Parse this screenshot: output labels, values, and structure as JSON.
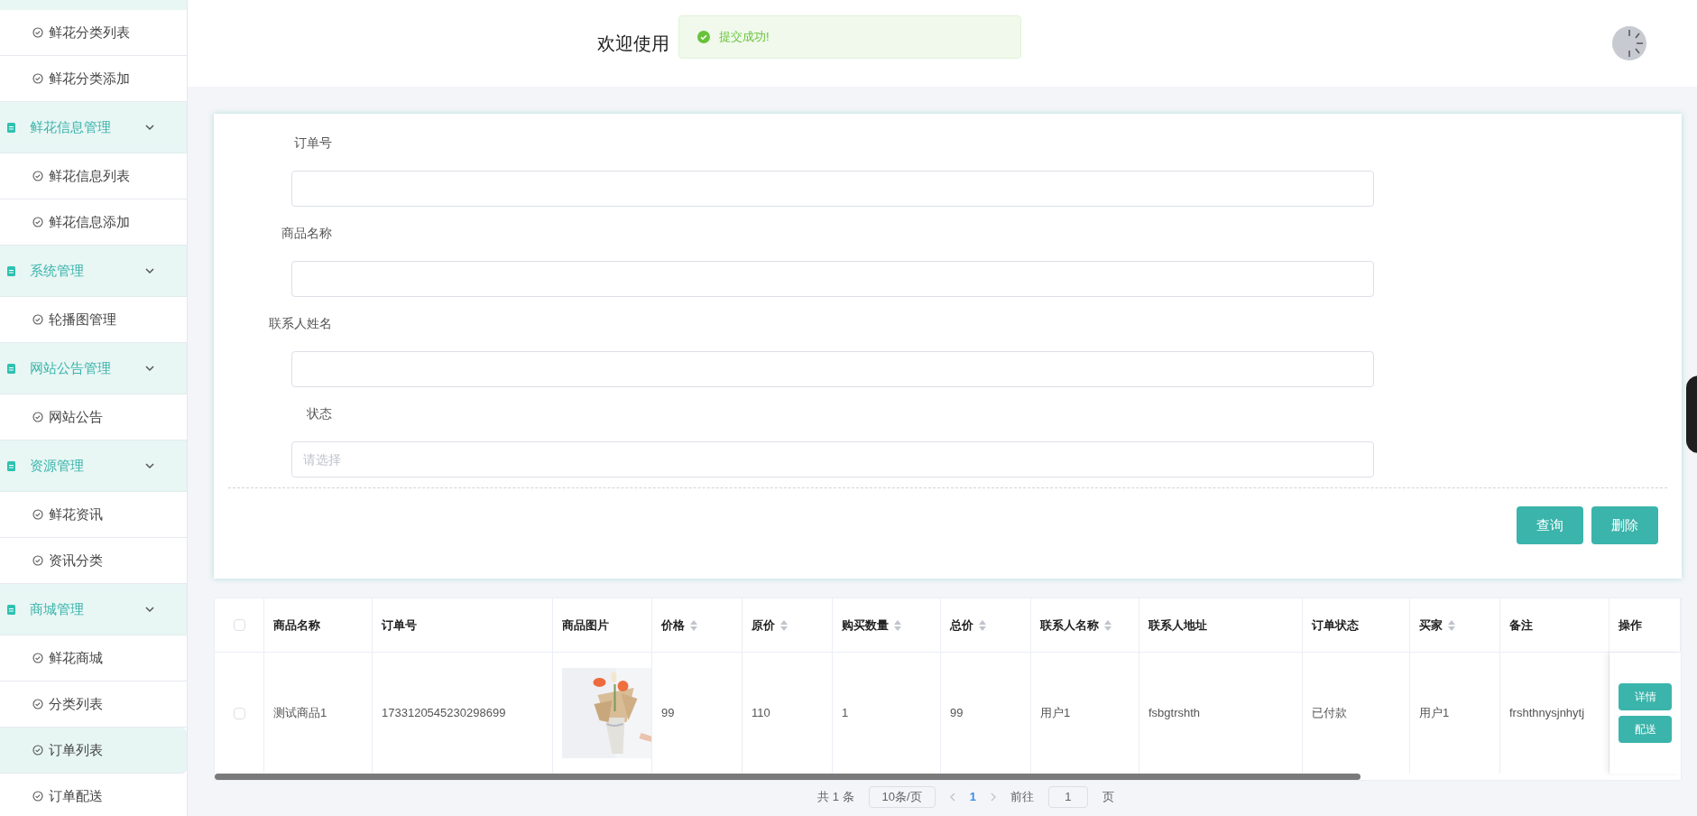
{
  "sidebar": {
    "items": [
      {
        "children": [
          {
            "label": "鲜花分类列表",
            "selected": false
          },
          {
            "label": "鲜花分类添加",
            "selected": false
          }
        ]
      },
      {
        "label": "鲜花信息管理",
        "expanded": true,
        "children": [
          {
            "label": "鲜花信息列表",
            "selected": false
          },
          {
            "label": "鲜花信息添加",
            "selected": false
          }
        ]
      },
      {
        "label": "系统管理",
        "expanded": true,
        "children": [
          {
            "label": "轮播图管理",
            "selected": false
          }
        ]
      },
      {
        "label": "网站公告管理",
        "expanded": true,
        "children": [
          {
            "label": "网站公告",
            "selected": false
          }
        ]
      },
      {
        "label": "资源管理",
        "expanded": true,
        "children": [
          {
            "label": "鲜花资讯",
            "selected": false
          },
          {
            "label": "资讯分类",
            "selected": false
          }
        ]
      },
      {
        "label": "商城管理",
        "expanded": true,
        "children": [
          {
            "label": "鲜花商城",
            "selected": false
          },
          {
            "label": "分类列表",
            "selected": false
          },
          {
            "label": "订单列表",
            "selected": true
          },
          {
            "label": "订单配送",
            "selected": false
          }
        ]
      }
    ]
  },
  "header": {
    "welcome": "欢迎使用"
  },
  "toast": {
    "message": "提交成功!"
  },
  "search_form": {
    "fields": [
      {
        "kind": "text",
        "label": "订单号"
      },
      {
        "kind": "text",
        "label": "商品名称"
      },
      {
        "kind": "text",
        "label": "联系人姓名"
      },
      {
        "kind": "select",
        "label": "状态",
        "placeholder": "请选择"
      }
    ],
    "buttons": [
      "查询",
      "删除"
    ]
  },
  "table": {
    "select_all_checked": false,
    "columns": [
      {
        "label": "商品名称",
        "sortable": false
      },
      {
        "label": "订单号",
        "sortable": false
      },
      {
        "label": "商品图片",
        "sortable": false
      },
      {
        "label": "价格",
        "sortable": true
      },
      {
        "label": "原价",
        "sortable": true
      },
      {
        "label": "购买数量",
        "sortable": true
      },
      {
        "label": "总价",
        "sortable": true
      },
      {
        "label": "联系人名称",
        "sortable": true
      },
      {
        "label": "联系人地址",
        "sortable": false
      },
      {
        "label": "订单状态",
        "sortable": false
      },
      {
        "label": "买家",
        "sortable": true
      },
      {
        "label": "备注",
        "sortable": false
      },
      {
        "label": "操作",
        "sortable": false
      }
    ],
    "rows": [
      {
        "checked": false,
        "cells": [
          "测试商品1",
          "1733120545230298699",
          {
            "kind": "picture"
          },
          "99",
          "110",
          "1",
          "99",
          "用户1",
          "fsbgtrshth",
          "已付款",
          "用户1",
          "frshthnysjnhytj"
        ],
        "actions": [
          "详情",
          "配送"
        ]
      }
    ]
  },
  "pagination": {
    "total": "共 1 条",
    "page_size": "10条/页",
    "pages": [
      {
        "label": "1",
        "selected": true
      }
    ],
    "goto_label": "前往",
    "goto_value": "1",
    "goto_suffix": "页"
  }
}
